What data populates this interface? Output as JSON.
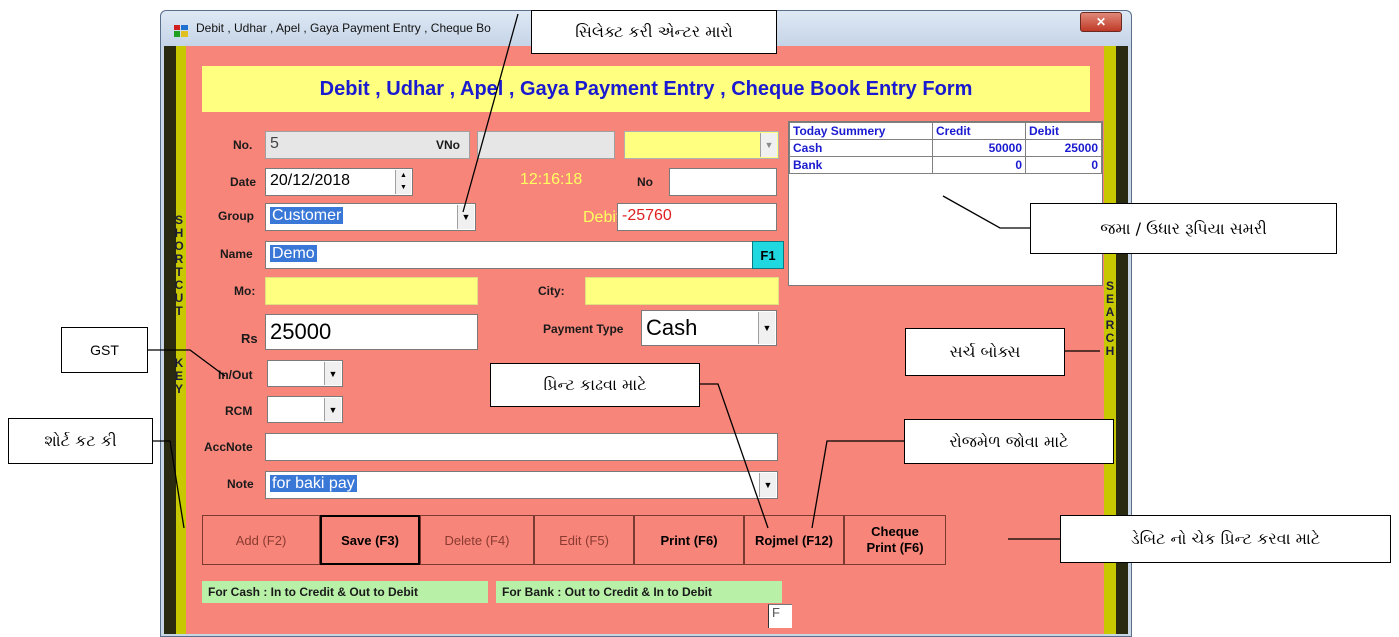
{
  "window": {
    "title": "Debit , Udhar , Apel , Gaya Payment Entry , Cheque Bo",
    "close_glyph": "✕"
  },
  "form": {
    "heading": "Debit , Udhar , Apel , Gaya Payment Entry , Cheque Book Entry Form",
    "no_label": "No.",
    "no_value": "5",
    "vno_label": "VNo",
    "vno_value": "",
    "date_label": "Date",
    "date_value": "20/12/2018",
    "time_value": "12:16:18",
    "no2_label": "No",
    "no2_value": "",
    "group_label": "Group",
    "group_value": "Customer",
    "debit_label": "Debit",
    "debit_value": "-25760",
    "name_label": "Name",
    "name_value": "Demo",
    "f1_label": "F1",
    "mo_label": "Mo:",
    "mo_value": "",
    "city_label": "City:",
    "city_value": "",
    "rs_label": "Rs",
    "rs_value": "25000",
    "payment_type_label": "Payment Type",
    "payment_type_value": "Cash",
    "inout_label": "In/Out",
    "inout_value": "",
    "rcm_label": "RCM",
    "rcm_value": "",
    "accnote_label": "AccNote",
    "accnote_value": "",
    "note_label": "Note",
    "note_value": "for baki pay",
    "shortcut_letters": [
      "S",
      "H",
      "O",
      "R",
      "T",
      "C",
      "U",
      "T",
      "",
      "K",
      "E",
      "Y"
    ],
    "search_letters": [
      "S",
      "E",
      "A",
      "R",
      "C",
      "H"
    ],
    "hint_cash": "For Cash : In to Credit  &  Out to Debit",
    "hint_bank": "For Bank : Out to Credit  &  In to Debit",
    "stray_text": "F"
  },
  "summary": {
    "headers": [
      "Today Summery",
      "Credit",
      "Debit"
    ],
    "rows": [
      {
        "label": "Cash",
        "credit": "50000",
        "debit": "25000"
      },
      {
        "label": "Bank",
        "credit": "0",
        "debit": "0"
      }
    ]
  },
  "buttons": {
    "add": "Add (F2)",
    "save": "Save (F3)",
    "delete": "Delete (F4)",
    "edit": "Edit (F5)",
    "print": "Print (F6)",
    "rojmel": "Rojmel (F12)",
    "cheque_line1": "Cheque",
    "cheque_line2": "Print (F6)"
  },
  "callouts": {
    "select_enter": "સિલેક્ટ કરી એન્ટર મારો",
    "summary": "જમા / ઉધાર  રૂપિયા સમરી",
    "gst": "GST",
    "search_box": "સર્ચ બોક્સ",
    "print_help": "પ્રિન્ટ કાઢવા માટે",
    "rojmel_help": "રોજમેળ જોવા માટે",
    "shortcut_key": "શોર્ટ કટ કી",
    "cheque_help": "ડેબિટ નો ચેક પ્રિન્ટ કરવા માટે"
  },
  "colors": {
    "form_bg": "#f7857a",
    "heading_bg": "#ffff80",
    "heading_text": "#1a1ad0",
    "side_bar": "#c8c800",
    "highlight": "#3a78d8",
    "hint_bg": "#b8f0a8"
  }
}
